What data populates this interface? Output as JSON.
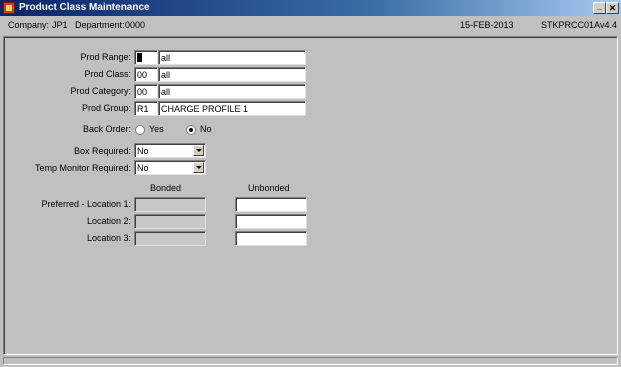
{
  "window": {
    "title": "Product Class Maintenance"
  },
  "infobar": {
    "company_label": "Company:",
    "company": "JP1",
    "department_label": "Department:",
    "department": "0000",
    "date": "15-FEB-2013",
    "program": "STKPRCC01A",
    "version": "v4.4"
  },
  "form": {
    "prod_range": {
      "label": "Prod Range:",
      "code": "",
      "desc": "all"
    },
    "prod_class": {
      "label": "Prod Class:",
      "code": "00",
      "desc": "all"
    },
    "prod_category": {
      "label": "Prod Category:",
      "code": "00",
      "desc": "all"
    },
    "prod_group": {
      "label": "Prod Group:",
      "code": "R1",
      "desc": "CHARGE PROFILE 1"
    },
    "back_order": {
      "label": "Back Order:",
      "yes": "Yes",
      "no": "No",
      "selected": "No"
    },
    "box_required": {
      "label": "Box Required:",
      "value": "No"
    },
    "temp_monitor": {
      "label": "Temp Monitor Required:",
      "value": "No"
    },
    "columns": {
      "bonded": "Bonded",
      "unbonded": "Unbonded"
    },
    "locations": [
      {
        "label": "Preferred - Location 1:"
      },
      {
        "label": "Location 2:"
      },
      {
        "label": "Location 3:"
      }
    ]
  }
}
